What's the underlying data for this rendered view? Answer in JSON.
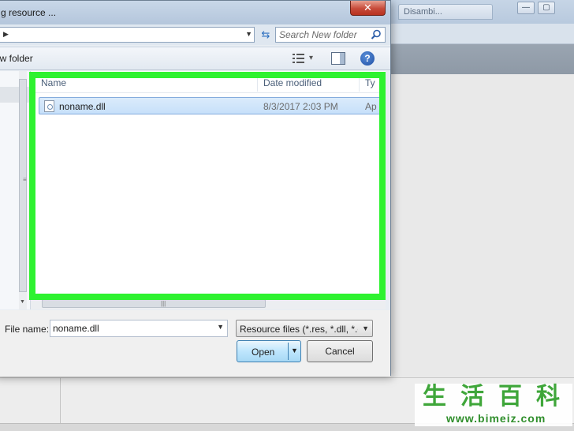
{
  "background_app": {
    "tab_label": "Disambi..."
  },
  "dialog": {
    "title": "g resource ...",
    "close_symbol": "✕",
    "search": {
      "placeholder": "Search New folder"
    },
    "toolbar": {
      "new_folder_label": "ew folder",
      "help_symbol": "?"
    },
    "columns": {
      "name": "Name",
      "date_modified": "Date modified",
      "type": "Ty"
    },
    "files": [
      {
        "name": "noname.dll",
        "date_modified": "8/3/2017 2:03 PM",
        "type": "Ap"
      }
    ],
    "file_name": {
      "label": "File name:",
      "value": "noname.dll"
    },
    "file_type_filter": {
      "selected": "Resource files (*.res, *.dll, *.exe)"
    },
    "buttons": {
      "open": "Open",
      "cancel": "Cancel"
    }
  },
  "highlight_color": "#2ef230",
  "watermark": {
    "chars": [
      "生",
      "活",
      "百",
      "科"
    ],
    "url": "www.bimeiz.com"
  },
  "icons": [
    "close-icon",
    "refresh-icon",
    "search-icon",
    "views-icon",
    "preview-pane-icon",
    "help-icon",
    "dll-file-icon",
    "chevron-down-icon"
  ]
}
